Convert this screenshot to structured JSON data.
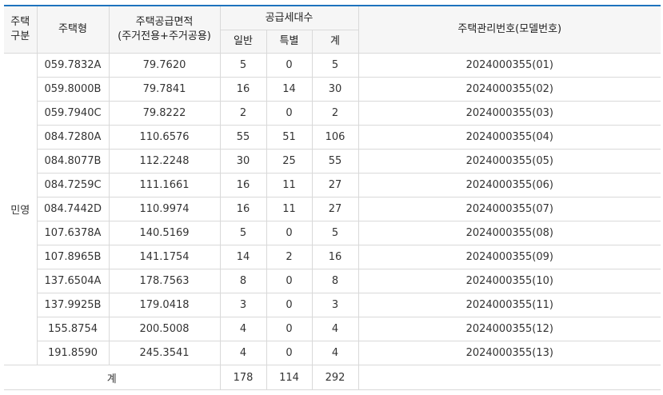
{
  "header": {
    "gubun_line1": "주택",
    "gubun_line2": "구분",
    "type": "주택형",
    "area_line1": "주택공급면적",
    "area_line2": "(주거전용+주거공용)",
    "supply": "공급세대수",
    "general": "일반",
    "special": "특별",
    "total": "계",
    "mgmt": "주택관리번호(모델번호)"
  },
  "group_label": "민영",
  "rows": [
    {
      "type": "059.7832A",
      "area": "79.7620",
      "general": "5",
      "special": "0",
      "total": "5",
      "mgmt": "2024000355(01)"
    },
    {
      "type": "059.8000B",
      "area": "79.7841",
      "general": "16",
      "special": "14",
      "total": "30",
      "mgmt": "2024000355(02)"
    },
    {
      "type": "059.7940C",
      "area": "79.8222",
      "general": "2",
      "special": "0",
      "total": "2",
      "mgmt": "2024000355(03)"
    },
    {
      "type": "084.7280A",
      "area": "110.6576",
      "general": "55",
      "special": "51",
      "total": "106",
      "mgmt": "2024000355(04)"
    },
    {
      "type": "084.8077B",
      "area": "112.2248",
      "general": "30",
      "special": "25",
      "total": "55",
      "mgmt": "2024000355(05)"
    },
    {
      "type": "084.7259C",
      "area": "111.1661",
      "general": "16",
      "special": "11",
      "total": "27",
      "mgmt": "2024000355(06)"
    },
    {
      "type": "084.7442D",
      "area": "110.9974",
      "general": "16",
      "special": "11",
      "total": "27",
      "mgmt": "2024000355(07)"
    },
    {
      "type": "107.6378A",
      "area": "140.5169",
      "general": "5",
      "special": "0",
      "total": "5",
      "mgmt": "2024000355(08)"
    },
    {
      "type": "107.8965B",
      "area": "141.1754",
      "general": "14",
      "special": "2",
      "total": "16",
      "mgmt": "2024000355(09)"
    },
    {
      "type": "137.6504A",
      "area": "178.7563",
      "general": "8",
      "special": "0",
      "total": "8",
      "mgmt": "2024000355(10)"
    },
    {
      "type": "137.9925B",
      "area": "179.0418",
      "general": "3",
      "special": "0",
      "total": "3",
      "mgmt": "2024000355(11)"
    },
    {
      "type": "155.8754",
      "area": "200.5008",
      "general": "4",
      "special": "0",
      "total": "4",
      "mgmt": "2024000355(12)"
    },
    {
      "type": "191.8590",
      "area": "245.3541",
      "general": "4",
      "special": "0",
      "total": "4",
      "mgmt": "2024000355(13)"
    }
  ],
  "totals": {
    "label": "계",
    "general": "178",
    "special": "114",
    "total": "292"
  }
}
